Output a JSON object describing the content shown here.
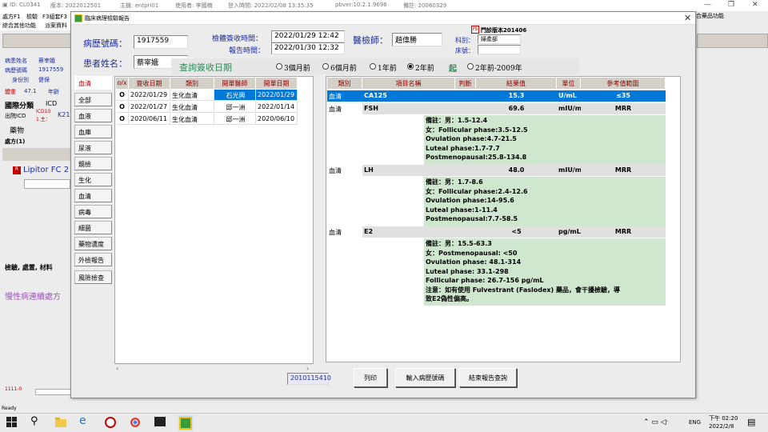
{
  "main_window": {
    "topbar": [
      "ID: CL0341",
      "版本: 2022012501",
      "主機: entpri01",
      "使用者: 李國楠",
      "登入時間: 2022/02/08 13:35:35",
      "pbver:10.2.1.9696",
      "備註: 20060329"
    ],
    "menu": [
      "處方F1",
      "檢驗",
      "F3組套F3",
      "綜合其他功能",
      "派案資料"
    ],
    "right_menu": "合藥品功能",
    "bg_labels": {
      "patient_name_lbl": "病患姓名",
      "patient_name": "蔡宰娥",
      "record_no_lbl": "病歷號碼",
      "record_no": "1917559",
      "id_lbl": "身份別",
      "id_val": "健保",
      "weight_lbl": "體重",
      "weight": "47.1",
      "age_lbl": "年齡",
      "intl_class": "國際分類",
      "icd": "ICD",
      "discharge_icd": "出院ICD",
      "icd10": "ICD10",
      "main": "1.主：",
      "k21": "K21",
      "drug": "藥物",
      "prescription": "處方(1)",
      "lipitor": "Lipitor FC 2",
      "exam_section": "檢驗, 處置, 材料",
      "chronic": "慢性病連續處方"
    }
  },
  "dialog": {
    "title": "臨床病理檢驗報告",
    "close": "✕",
    "record_no_label": "病歷號碼：",
    "record_no": "1917559",
    "patient_name_label": "患者姓名：",
    "patient_name": "蔡宰娥",
    "collect_time_label": "檢體簽收時間：",
    "collect_time": "2022/01/29 12:42",
    "report_time_label": "報告時間：",
    "report_time": "2022/01/30 12:32",
    "doctor_label": "醫檢師：",
    "doctor": "趙偉勝",
    "version_badge": "FS",
    "version": "門診版本201406",
    "dept_label": "科別：",
    "dept": "婦產部",
    "bed_label": "床號：",
    "bed": "",
    "query_label": "查詢簽收日期",
    "query_options": [
      "3個月前",
      "6個月前",
      "1年前",
      "2年前",
      "2年前-2009年"
    ],
    "query_selected": 3,
    "start_label": "起",
    "categories": [
      "血清",
      "全部",
      "血液",
      "血庫",
      "尿液",
      "鏡檢",
      "生化",
      "血清",
      "病毒",
      "細菌",
      "藥物濃度",
      "外檢報告",
      "風險檢查"
    ],
    "order_headers": [
      "o/x",
      "簽收日期",
      "類別",
      "開單醫師",
      "開單日期"
    ],
    "orders": [
      [
        "O",
        "2022/01/29",
        "生化血清",
        "石光興",
        "2022/01/29"
      ],
      [
        "O",
        "2022/01/27",
        "生化血清",
        "邱一洲",
        "2022/01/14"
      ],
      [
        "O",
        "2020/06/11",
        "生化血清",
        "邱一洲",
        "2020/06/10"
      ]
    ],
    "result_headers": [
      "類別",
      "項目名稱",
      "判斷",
      "結果值",
      "單位",
      "參考值範圍"
    ],
    "results": [
      {
        "cat": "血清",
        "item": "CA125",
        "flag": "",
        "value": "15.3",
        "unit": "U/mL",
        "ref": "≤35",
        "notes": []
      },
      {
        "cat": "血清",
        "item": "FSH",
        "flag": "",
        "value": "69.6",
        "unit": "mIU/mL",
        "ref": "MRR",
        "notes": [
          "備註：男：1.5-12.4",
          "女：Follicular phase:3.5-12.5",
          "Ovulation phase:4.7-21.5",
          "Luteal phase:1.7-7.7",
          "Postmenopausal:25.8-134.8"
        ]
      },
      {
        "cat": "血清",
        "item": "LH",
        "flag": "",
        "value": "48.0",
        "unit": "mIU/mL",
        "ref": "MRR",
        "notes": [
          "備註：男：1.7-8.6",
          "女：Follicular phase:2.4-12.6",
          "Ovulation phase:14-95.6",
          "Luteal phase:1-11.4",
          "Postmenopausal:7.7-58.5"
        ]
      },
      {
        "cat": "血清",
        "item": "E2",
        "flag": "",
        "value": "<5",
        "unit": "pg/mL",
        "ref": "MRR",
        "notes": [
          "備註：男：15.5-63.3",
          "女：Postmenopausal: <50",
          "   Ovulation phase: 48.1-314",
          "   Luteal phase: 33.1-298",
          "   Follicular phase: 26.7-156 pg/mL",
          "注意：如有使用 Fulvestrant (Faslodex) 藥品，會干擾檢驗，導",
          "致E2偽性偏高。"
        ]
      }
    ],
    "order_no": "2010115410",
    "buttons": [
      "列印",
      "輸入病歷號碼",
      "結束報告查詢"
    ]
  },
  "statusbar": "Ready",
  "taskbar": {
    "time": "下午 02:20",
    "date": "2022/2/8",
    "lang": "ENG"
  }
}
